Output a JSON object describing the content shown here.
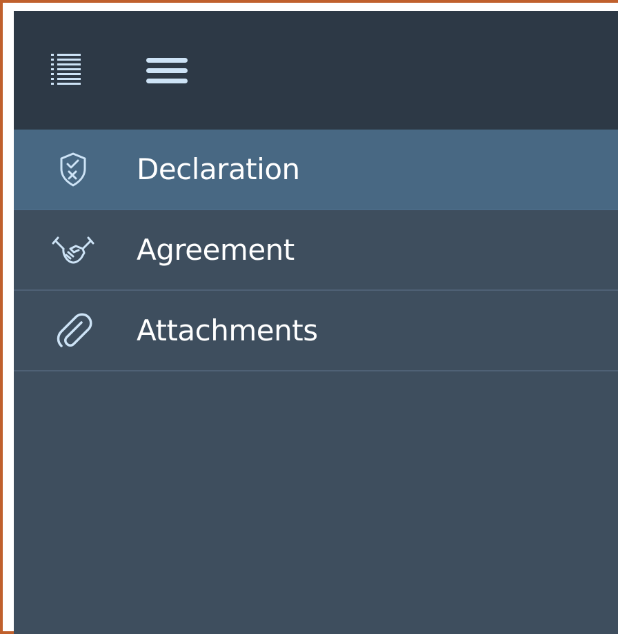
{
  "toolbar": {
    "icons": [
      "list-icon",
      "hamburger-menu-icon"
    ]
  },
  "nav": {
    "items": [
      {
        "label": "Declaration",
        "icon": "shield-check-icon",
        "selected": true
      },
      {
        "label": "Agreement",
        "icon": "handshake-icon",
        "selected": false
      },
      {
        "label": "Attachments",
        "icon": "paperclip-icon",
        "selected": false
      }
    ]
  },
  "colors": {
    "topbar": "#2d3946",
    "panel": "#3e4e5e",
    "selected": "#486883",
    "icon": "#cde3f6",
    "border": "#c0602c"
  }
}
